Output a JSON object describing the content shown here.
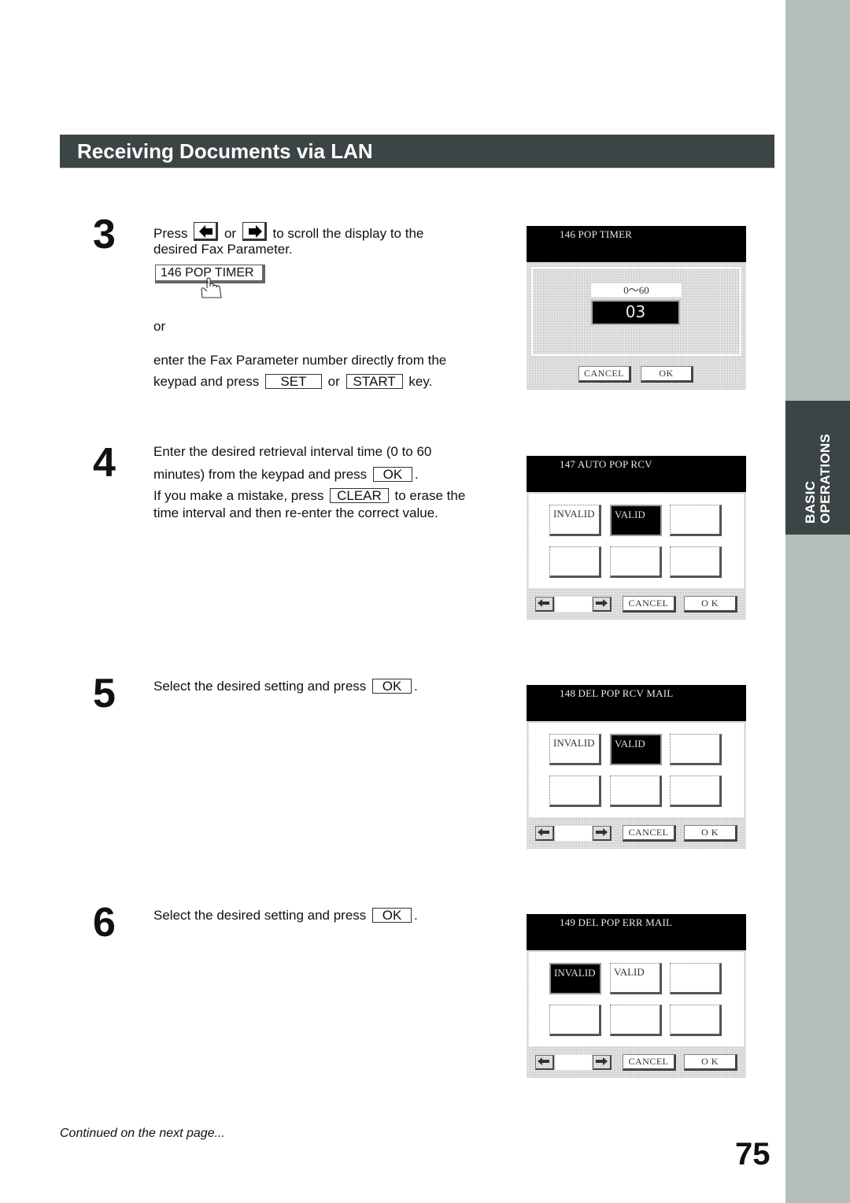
{
  "header": {
    "title": "Receiving Documents via LAN"
  },
  "side_tab": {
    "line1": "BASIC",
    "line2": "OPERATIONS"
  },
  "steps": [
    {
      "number": "3",
      "line1_before": "Press",
      "line1_or": "or",
      "line1_after": "to scroll the display to the",
      "line2": "desired Fax Parameter.",
      "param_button": "146 POP TIMER",
      "or_text": "or",
      "line3": "enter the Fax Parameter number directly from the",
      "line4_before": "keypad and press",
      "key_set": "SET",
      "line4_or": "or",
      "key_start": "START",
      "line4_after": "key."
    },
    {
      "number": "4",
      "line1": "Enter the desired retrieval interval time (0 to 60",
      "line2_before": "minutes) from the keypad and press",
      "key_ok": "OK",
      "line2_after": ".",
      "line3_before": "If you make a mistake, press",
      "key_clear": "CLEAR",
      "line3_after": "to erase the",
      "line4": "time interval and then re-enter the correct value."
    },
    {
      "number": "5",
      "text_before": "Select the desired setting and press",
      "key_ok": "OK",
      "text_after": "."
    },
    {
      "number": "6",
      "text_before": "Select the desired setting and press",
      "key_ok": "OK",
      "text_after": "."
    }
  ],
  "screens": [
    {
      "title": "146 POP TIMER",
      "range": "0～60",
      "value": "03",
      "cancel": "CANCEL",
      "ok": "OK"
    },
    {
      "title": "147 AUTO POP RCV",
      "options": [
        "INVALID",
        "VALID"
      ],
      "selected": "VALID",
      "cancel": "CANCEL",
      "ok": "O K"
    },
    {
      "title": "148 DEL POP RCV MAIL",
      "options": [
        "INVALID",
        "VALID"
      ],
      "selected": "VALID",
      "cancel": "CANCEL",
      "ok": "O K"
    },
    {
      "title": "149 DEL POP ERR MAIL",
      "options": [
        "INVALID",
        "VALID"
      ],
      "selected": "INVALID",
      "cancel": "CANCEL",
      "ok": "O K"
    }
  ],
  "footer": {
    "continued": "Continued on the next page...",
    "page_number": "75"
  }
}
